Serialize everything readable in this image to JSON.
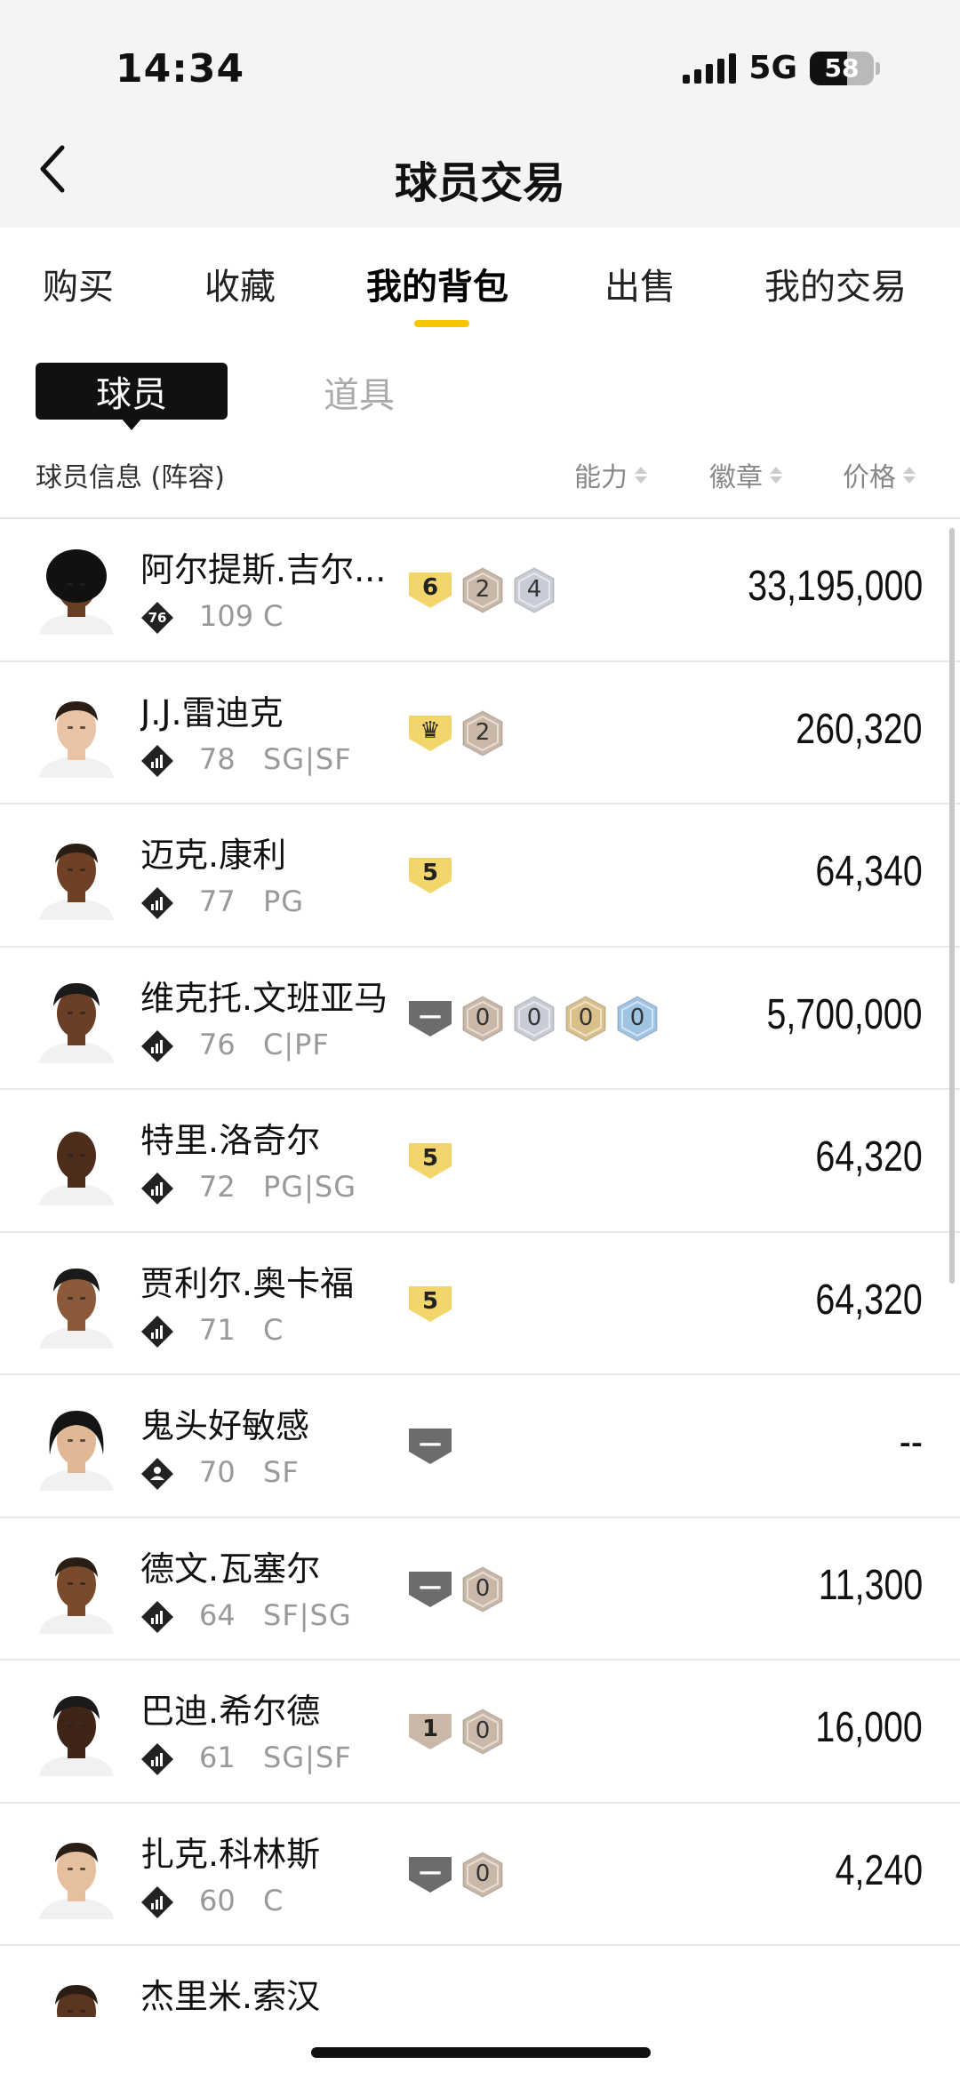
{
  "status": {
    "time": "14:34",
    "network": "5G",
    "battery": "58"
  },
  "header": {
    "title": "球员交易"
  },
  "tabs": [
    {
      "label": "购买",
      "active": false
    },
    {
      "label": "收藏",
      "active": false
    },
    {
      "label": "我的背包",
      "active": true
    },
    {
      "label": "出售",
      "active": false
    },
    {
      "label": "我的交易",
      "active": false
    }
  ],
  "subtabs": {
    "player": "球员",
    "item": "道具"
  },
  "columns": {
    "info": "球员信息 (阵容)",
    "ability": "能力",
    "badge": "徽章",
    "price": "价格"
  },
  "colors": {
    "accent": "#f7c600",
    "gold": "#f3d66b",
    "bronze": "#c9b8a7",
    "silver": "#c9cbd6",
    "hof": "#d9c08a",
    "legend": "#9ec3e3",
    "gray": "#6c6c6c"
  },
  "players": [
    {
      "name": "阿尔提斯.吉尔...",
      "rank": "76",
      "rank_icon": "rank-76-icon",
      "ovr": "109",
      "pos": "C",
      "price": "33,195,000",
      "skin": "#6a3e22",
      "hair": "afro",
      "badges": [
        {
          "kind": "shield",
          "color": "gold",
          "text": "6"
        },
        {
          "kind": "hex",
          "color": "bronze",
          "text": "2"
        },
        {
          "kind": "hex",
          "color": "silver",
          "text": "4"
        }
      ]
    },
    {
      "name": "J.J.雷迪克",
      "rank": "",
      "rank_icon": "rank-bars-icon",
      "ovr": "78",
      "pos": "SG|SF",
      "price": "260,320",
      "skin": "#e9c3a6",
      "hair": "short",
      "badges": [
        {
          "kind": "shield",
          "color": "gold",
          "text": "♛"
        },
        {
          "kind": "hex",
          "color": "bronze",
          "text": "2"
        }
      ]
    },
    {
      "name": "迈克.康利",
      "rank": "",
      "rank_icon": "rank-bars-icon",
      "ovr": "77",
      "pos": "PG",
      "price": "64,340",
      "skin": "#6e4126",
      "hair": "short",
      "badges": [
        {
          "kind": "shield",
          "color": "gold",
          "text": "5"
        }
      ]
    },
    {
      "name": "维克托.文班亚马",
      "rank": "",
      "rank_icon": "rank-bars-icon",
      "ovr": "76",
      "pos": "C|PF",
      "price": "5,700,000",
      "skin": "#6b3f26",
      "hair": "curly",
      "badges": [
        {
          "kind": "shield",
          "color": "gray",
          "text": "—"
        },
        {
          "kind": "hex",
          "color": "bronze",
          "text": "0"
        },
        {
          "kind": "hex",
          "color": "silver",
          "text": "0"
        },
        {
          "kind": "hex",
          "color": "hof",
          "text": "0"
        },
        {
          "kind": "hex",
          "color": "legend",
          "text": "0"
        }
      ]
    },
    {
      "name": "特里.洛奇尔",
      "rank": "",
      "rank_icon": "rank-bars-icon",
      "ovr": "72",
      "pos": "PG|SG",
      "price": "64,320",
      "skin": "#4d2c1c",
      "hair": "bald",
      "badges": [
        {
          "kind": "shield",
          "color": "gold",
          "text": "5"
        }
      ]
    },
    {
      "name": "贾利尔.奥卡福",
      "rank": "",
      "rank_icon": "rank-bars-icon",
      "ovr": "71",
      "pos": "C",
      "price": "64,320",
      "skin": "#8a5a3b",
      "hair": "curly",
      "badges": [
        {
          "kind": "shield",
          "color": "gold",
          "text": "5"
        }
      ]
    },
    {
      "name": "鬼头好敏感",
      "rank": "",
      "rank_icon": "rank-person-icon",
      "ovr": "70",
      "pos": "SF",
      "price": "--",
      "skin": "#e1b896",
      "hair": "long",
      "badges": [
        {
          "kind": "shield",
          "color": "gray",
          "text": "—"
        }
      ]
    },
    {
      "name": "德文.瓦塞尔",
      "rank": "",
      "rank_icon": "rank-bars-icon",
      "ovr": "64",
      "pos": "SF|SG",
      "price": "11,300",
      "skin": "#7a4a2c",
      "hair": "short",
      "badges": [
        {
          "kind": "shield",
          "color": "gray",
          "text": "—"
        },
        {
          "kind": "hex",
          "color": "bronze",
          "text": "0"
        }
      ]
    },
    {
      "name": "巴迪.希尔德",
      "rank": "",
      "rank_icon": "rank-bars-icon",
      "ovr": "61",
      "pos": "SG|SF",
      "price": "16,000",
      "skin": "#3e2517",
      "hair": "curly",
      "badges": [
        {
          "kind": "shield",
          "color": "bronze",
          "text": "1"
        },
        {
          "kind": "hex",
          "color": "bronze",
          "text": "0"
        }
      ]
    },
    {
      "name": "扎克.科林斯",
      "rank": "",
      "rank_icon": "rank-bars-icon",
      "ovr": "60",
      "pos": "C",
      "price": "4,240",
      "skin": "#e6bf9f",
      "hair": "short",
      "badges": [
        {
          "kind": "shield",
          "color": "gray",
          "text": "—"
        },
        {
          "kind": "hex",
          "color": "bronze",
          "text": "0"
        }
      ]
    }
  ],
  "partial_row": {
    "name": "杰里米.索汉"
  }
}
